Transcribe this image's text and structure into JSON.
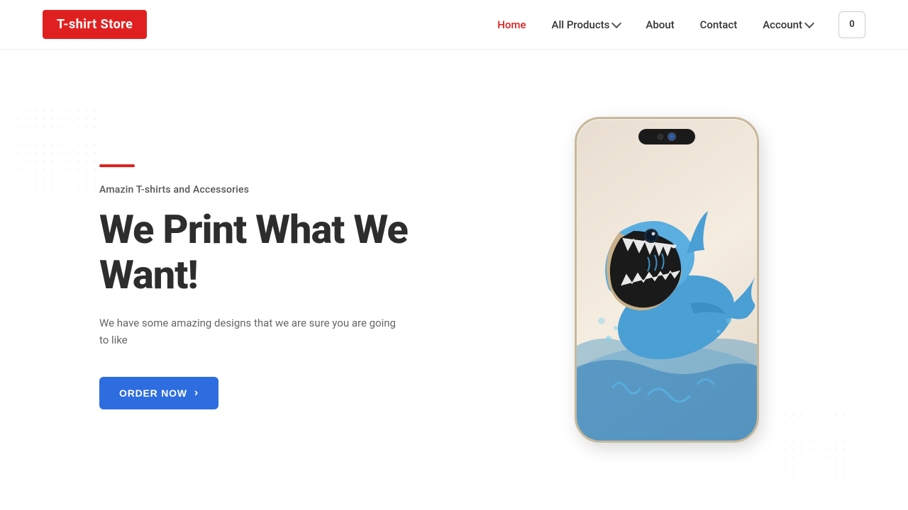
{
  "brand": {
    "name": "T-shirt Store"
  },
  "nav": {
    "home_label": "Home",
    "products_label": "All Products",
    "about_label": "About",
    "contact_label": "Contact",
    "account_label": "Account",
    "cart_count": "0"
  },
  "hero": {
    "subtitle": "Amazin T-shirts and Accessories",
    "title": "We Print What We Want!",
    "description": "We have some amazing designs that we are sure you are going to like",
    "cta_label": "ORDER NOW"
  }
}
